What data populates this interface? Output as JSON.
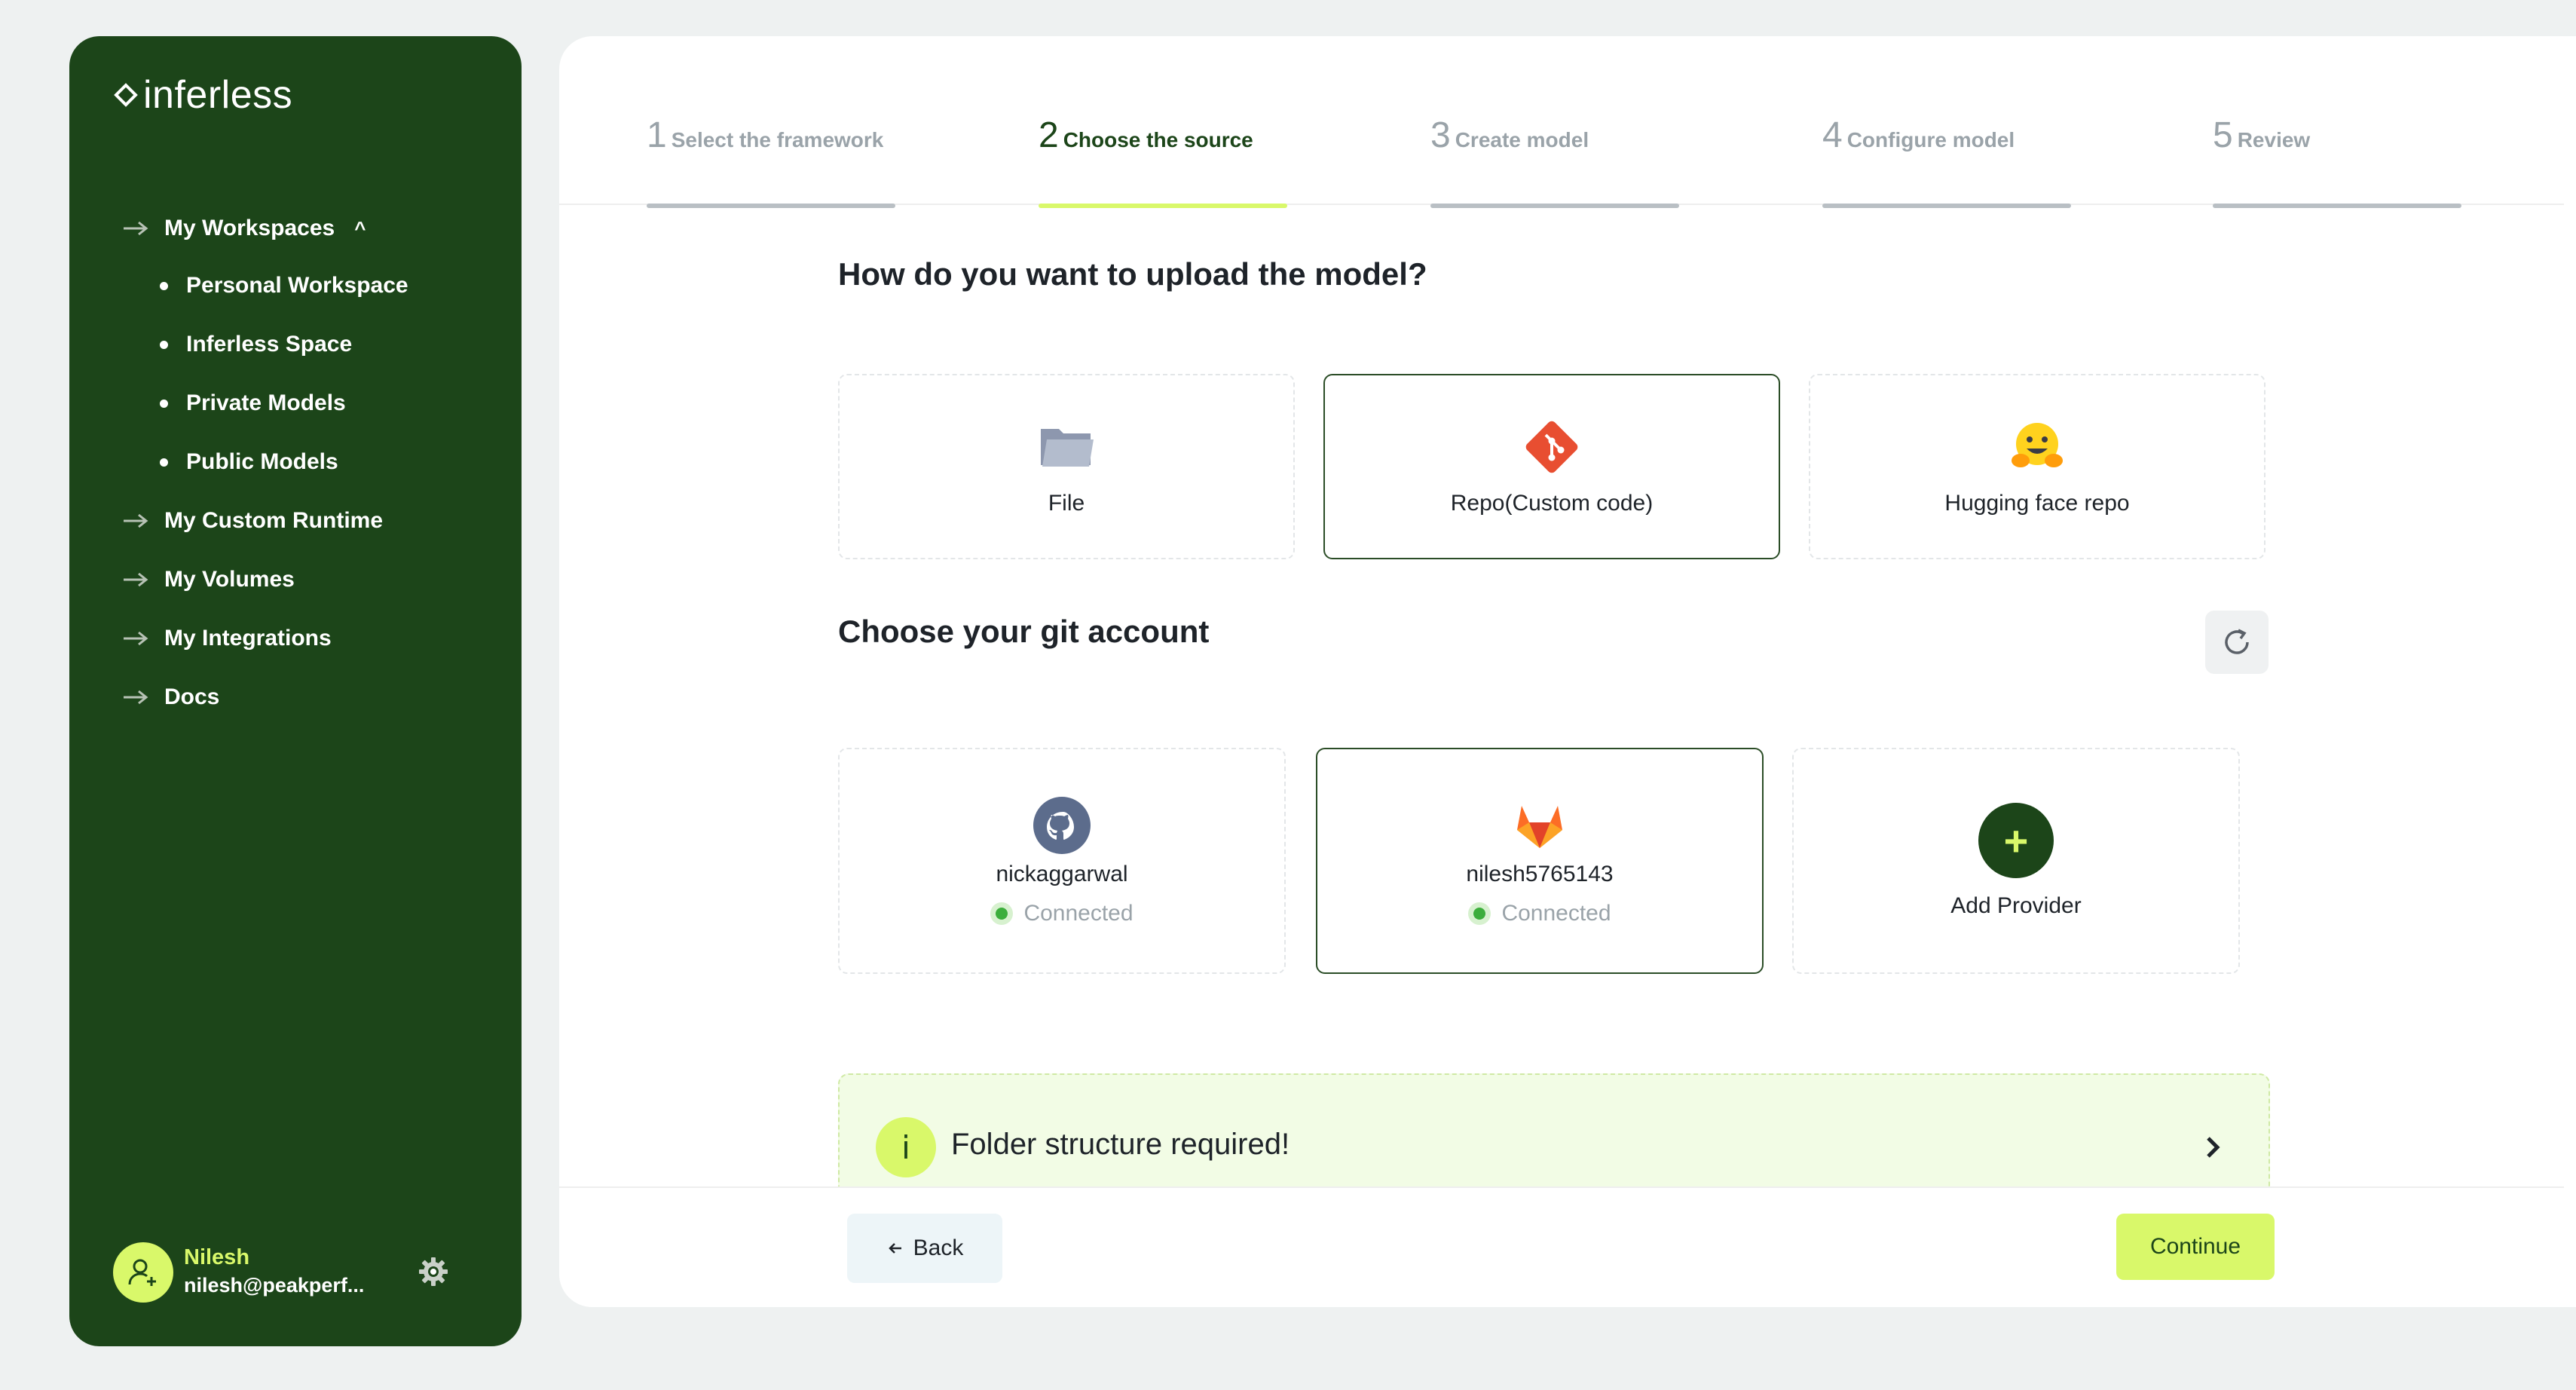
{
  "app": {
    "brand": "inferless"
  },
  "sidebar": {
    "workspaces_label": "My Workspaces",
    "workspace_items": [
      {
        "label": "Personal Workspace"
      },
      {
        "label": "Inferless Space"
      },
      {
        "label": "Private Models"
      },
      {
        "label": "Public Models"
      }
    ],
    "nav_items": [
      {
        "label": "My Custom Runtime"
      },
      {
        "label": "My Volumes"
      },
      {
        "label": "My Integrations"
      },
      {
        "label": "Docs"
      }
    ],
    "user": {
      "name": "Nilesh",
      "email": "nilesh@peakperf..."
    }
  },
  "stepper": {
    "steps": [
      {
        "num": "1",
        "label": "Select the framework",
        "active": false
      },
      {
        "num": "2",
        "label": "Choose the source",
        "active": true
      },
      {
        "num": "3",
        "label": "Create model",
        "active": false
      },
      {
        "num": "4",
        "label": "Configure model",
        "active": false
      },
      {
        "num": "5",
        "label": "Review",
        "active": false
      }
    ]
  },
  "upload": {
    "title": "How do you want to upload the model?",
    "options": [
      {
        "label": "File",
        "icon": "folder-icon",
        "selected": false
      },
      {
        "label": "Repo(Custom code)",
        "icon": "git-icon",
        "selected": true
      },
      {
        "label": "Hugging face repo",
        "icon": "hugging-face-icon",
        "selected": false
      }
    ]
  },
  "git": {
    "title": "Choose your git account",
    "accounts": [
      {
        "name": "nickaggarwal",
        "status": "Connected",
        "icon": "github-icon",
        "selected": false
      },
      {
        "name": "nilesh5765143",
        "status": "Connected",
        "icon": "gitlab-icon",
        "selected": true
      }
    ],
    "add_provider_label": "Add Provider"
  },
  "banner": {
    "text": "Folder structure required!",
    "icon_glyph": "i"
  },
  "footer": {
    "back_label": "Back",
    "continue_label": "Continue"
  },
  "colors": {
    "sidebar_bg": "#1c4519",
    "accent": "#d9f86a",
    "connected": "#3cae3c"
  }
}
